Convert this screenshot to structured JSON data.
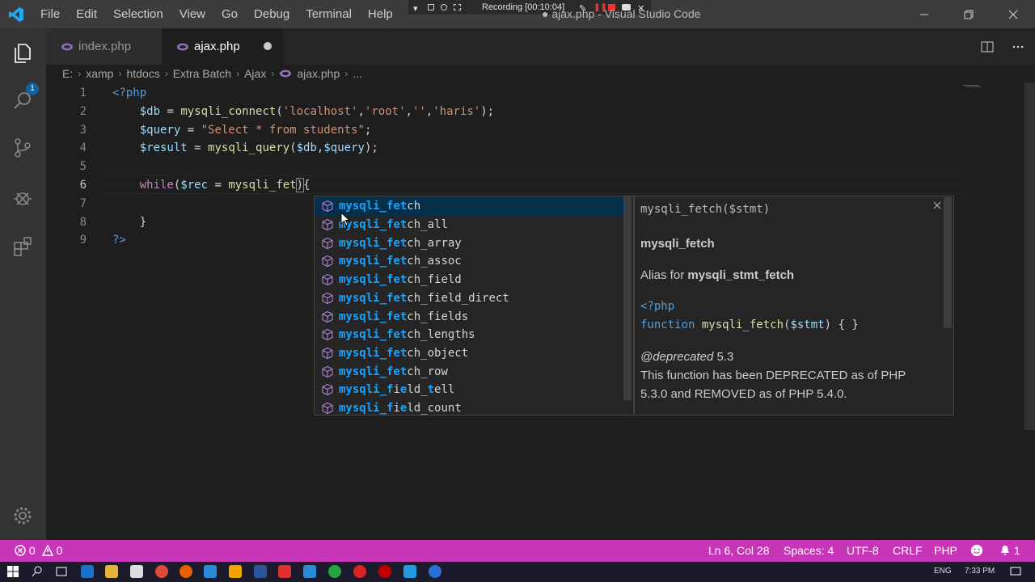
{
  "titlebar": {
    "menu": [
      "File",
      "Edit",
      "Selection",
      "View",
      "Go",
      "Debug",
      "Terminal",
      "Help"
    ],
    "recording": "Recording [00:10:04]",
    "window_title": "● ajax.php - Visual Studio Code"
  },
  "activitybar": {
    "explorer_badge": "1",
    "icons": [
      "files-icon",
      "search-icon",
      "source-control-icon",
      "debug-icon",
      "extensions-icon",
      "settings-gear-icon"
    ]
  },
  "tabs": [
    {
      "label": "index.php",
      "active": false,
      "dirty": false
    },
    {
      "label": "ajax.php",
      "active": true,
      "dirty": true
    }
  ],
  "breadcrumb": [
    "E:",
    "xamp",
    "htdocs",
    "Extra Batch",
    "Ajax",
    "ajax.php",
    "..."
  ],
  "editor": {
    "line_numbers": [
      "1",
      "2",
      "3",
      "4",
      "5",
      "6",
      "7",
      "8",
      "9"
    ],
    "current_line": 6,
    "code": [
      [
        {
          "t": "tag",
          "s": "<?php"
        }
      ],
      [
        {
          "t": "sp",
          "s": "    "
        },
        {
          "t": "var",
          "s": "$db"
        },
        {
          "t": "op",
          "s": " = "
        },
        {
          "t": "fn",
          "s": "mysqli_connect"
        },
        {
          "t": "op",
          "s": "("
        },
        {
          "t": "str",
          "s": "'localhost'"
        },
        {
          "t": "op",
          "s": ","
        },
        {
          "t": "str",
          "s": "'root'"
        },
        {
          "t": "op",
          "s": ","
        },
        {
          "t": "str",
          "s": "''"
        },
        {
          "t": "op",
          "s": ","
        },
        {
          "t": "str",
          "s": "'haris'"
        },
        {
          "t": "op",
          "s": ");"
        }
      ],
      [
        {
          "t": "sp",
          "s": "    "
        },
        {
          "t": "var",
          "s": "$query"
        },
        {
          "t": "op",
          "s": " = "
        },
        {
          "t": "str",
          "s": "\"Select * from students\""
        },
        {
          "t": "op",
          "s": ";"
        }
      ],
      [
        {
          "t": "sp",
          "s": "    "
        },
        {
          "t": "var",
          "s": "$result"
        },
        {
          "t": "op",
          "s": " = "
        },
        {
          "t": "fn",
          "s": "mysqli_query"
        },
        {
          "t": "op",
          "s": "("
        },
        {
          "t": "var",
          "s": "$db"
        },
        {
          "t": "op",
          "s": ","
        },
        {
          "t": "var",
          "s": "$query"
        },
        {
          "t": "op",
          "s": ");"
        }
      ],
      [],
      [
        {
          "t": "sp",
          "s": "    "
        },
        {
          "t": "kw",
          "s": "while"
        },
        {
          "t": "op",
          "s": "("
        },
        {
          "t": "var",
          "s": "$rec"
        },
        {
          "t": "op",
          "s": " = "
        },
        {
          "t": "fn",
          "s": "mysqli_fet"
        },
        {
          "t": "br",
          "s": ")"
        },
        {
          "t": "op",
          "s": "{"
        }
      ],
      [],
      [
        {
          "t": "sp",
          "s": "    "
        },
        {
          "t": "op",
          "s": "}"
        }
      ],
      [
        {
          "t": "tag",
          "s": "?>"
        }
      ]
    ]
  },
  "suggest": {
    "typed": "mysqli_fet",
    "items": [
      {
        "match": "mysqli_fet",
        "rest": "ch"
      },
      {
        "match": "mysqli_fet",
        "rest": "ch_all"
      },
      {
        "match": "mysqli_fet",
        "rest": "ch_array"
      },
      {
        "match": "mysqli_fet",
        "rest": "ch_assoc"
      },
      {
        "match": "mysqli_fet",
        "rest": "ch_field"
      },
      {
        "match": "mysqli_fet",
        "rest": "ch_field_direct"
      },
      {
        "match": "mysqli_fet",
        "rest": "ch_fields"
      },
      {
        "match": "mysqli_fet",
        "rest": "ch_lengths"
      },
      {
        "match": "mysqli_fet",
        "rest": "ch_object"
      },
      {
        "match": "mysqli_fet",
        "rest": "ch_row"
      },
      {
        "parts": [
          [
            "m",
            "mysqli_f"
          ],
          [
            "r",
            "i"
          ],
          [
            "m",
            "e"
          ],
          [
            "r",
            "ld_"
          ],
          [
            "m",
            "t"
          ],
          [
            "r",
            "ell"
          ]
        ]
      },
      {
        "parts": [
          [
            "m",
            "mysqli_f"
          ],
          [
            "r",
            "i"
          ],
          [
            "m",
            "e"
          ],
          [
            "r",
            "ld_count"
          ]
        ]
      }
    ]
  },
  "details": {
    "signature": "mysqli_fetch($stmt)",
    "name": "mysqli_fetch",
    "alias_prefix": "Alias for ",
    "alias_target": "mysqli_stmt_fetch",
    "code_open": "<?php",
    "code_kw": "function ",
    "code_fn": "mysqli_fetch",
    "code_args_open": "(",
    "code_arg": "$stmt",
    "code_tail": ") { }",
    "deprecated_tag": "@deprecated",
    "deprecated_version": " 5.3",
    "note_line1": "This function has been DEPRECATED as of PHP",
    "note_line2": "5.3.0 and REMOVED as of PHP 5.4.0."
  },
  "statusbar": {
    "errors": "0",
    "warnings": "0",
    "position": "Ln 6, Col 28",
    "spaces": "Spaces: 4",
    "encoding": "UTF-8",
    "eol": "CRLF",
    "language": "PHP",
    "notifications": "1"
  },
  "taskbar": {
    "lang": "ENG",
    "time": "7:33 PM"
  },
  "colors": {
    "statusbar": "#c836b8",
    "accent": "#007acc",
    "match": "#18a3ff"
  }
}
